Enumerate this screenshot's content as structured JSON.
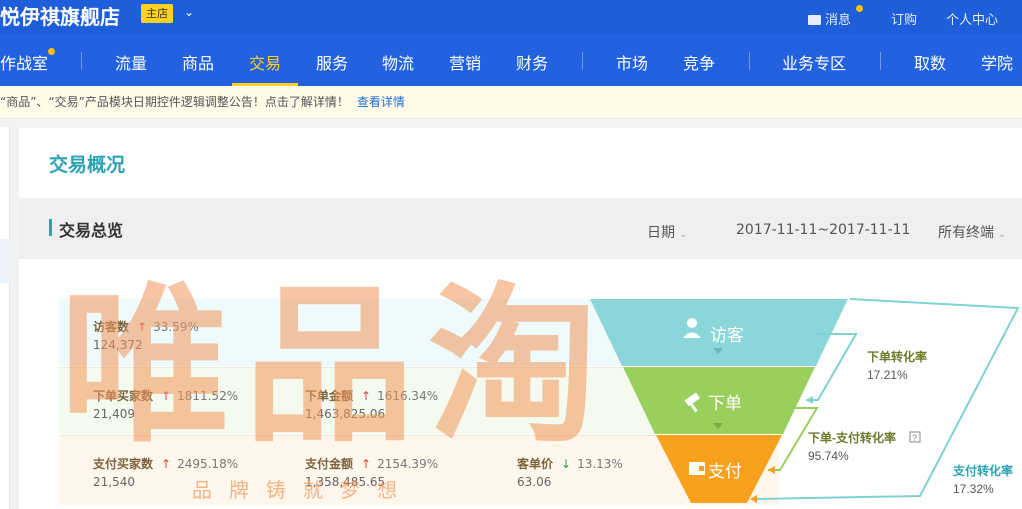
{
  "header": {
    "shop_name": "悦伊祺旗舰店",
    "shop_badge": "主店",
    "messages_label": "消息",
    "orders_label": "订购",
    "personal_center_label": "个人中心"
  },
  "nav": {
    "items": [
      {
        "label": "作战室"
      },
      {
        "label": "流量"
      },
      {
        "label": "商品"
      },
      {
        "label": "交易",
        "active": true
      },
      {
        "label": "服务"
      },
      {
        "label": "物流"
      },
      {
        "label": "营销"
      },
      {
        "label": "财务"
      },
      {
        "label": "市场"
      },
      {
        "label": "竞争"
      },
      {
        "label": "业务专区"
      },
      {
        "label": "取数"
      },
      {
        "label": "学院"
      }
    ]
  },
  "notice": {
    "text": "“商品”、“交易”产品模块日期控件逻辑调整公告！点击了解详情！",
    "link": "查看详情"
  },
  "page": {
    "title": "交易概况",
    "section_title": "交易总览",
    "date_label": "日期",
    "date_range": "2017-11-11~2017-11-11",
    "terminal_label": "所有终端"
  },
  "metrics": {
    "visitors": {
      "label": "访客数",
      "change": "33.59%",
      "direction": "up",
      "value": "124,372"
    },
    "order_buyers": {
      "label": "下单买家数",
      "change": "1811.52%",
      "direction": "up",
      "value": "21,409"
    },
    "order_amount": {
      "label": "下单金额",
      "change": "1616.34%",
      "direction": "up",
      "value": "1,463,825.06"
    },
    "pay_buyers": {
      "label": "支付买家数",
      "change": "2495.18%",
      "direction": "up",
      "value": "21,540"
    },
    "pay_amount": {
      "label": "支付金额",
      "change": "2154.39%",
      "direction": "up",
      "value": "1,358,485.65"
    },
    "unit_price": {
      "label": "客单价",
      "change": "13.13%",
      "direction": "down",
      "value": "63.06"
    }
  },
  "funnel": {
    "visit_label": "访客",
    "order_label": "下单",
    "pay_label": "支付",
    "order_rate_label": "下单转化率",
    "order_rate_value": "17.21%",
    "order_pay_rate_label": "下单-支付转化率",
    "order_pay_rate_value": "95.74%",
    "pay_rate_label": "支付转化率",
    "pay_rate_value": "17.32%"
  },
  "watermark": {
    "text": "唯品淘",
    "slogan": "品牌铸就梦想"
  },
  "colors": {
    "nav_blue": "#2262e0",
    "accent_yellow": "#ffd21e",
    "teal": "#2ba3b3",
    "funnel_visit": "#8bd6d8",
    "funnel_order": "#99cf5c",
    "funnel_pay": "#f7a11c"
  }
}
